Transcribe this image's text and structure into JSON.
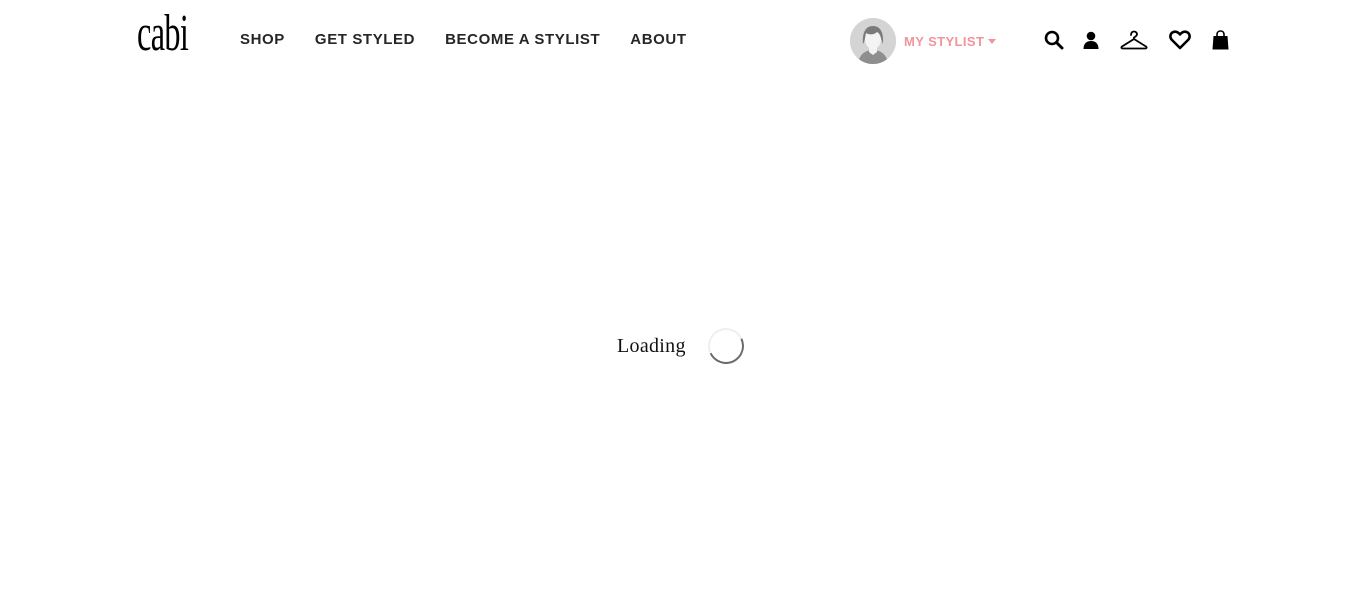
{
  "brand": {
    "logo_text": "cabi"
  },
  "nav": {
    "items": [
      {
        "label": "SHOP"
      },
      {
        "label": "GET STYLED"
      },
      {
        "label": "BECOME A STYLIST"
      },
      {
        "label": "ABOUT"
      }
    ]
  },
  "stylist": {
    "label": "MY STYLIST",
    "color": "#f1949c",
    "avatar_icon": "user-avatar-icon"
  },
  "header_icons": [
    {
      "name": "search-icon"
    },
    {
      "name": "account-icon"
    },
    {
      "name": "hanger-icon"
    },
    {
      "name": "heart-icon"
    },
    {
      "name": "shopping-bag-icon"
    }
  ],
  "main": {
    "loading_text": "Loading"
  }
}
